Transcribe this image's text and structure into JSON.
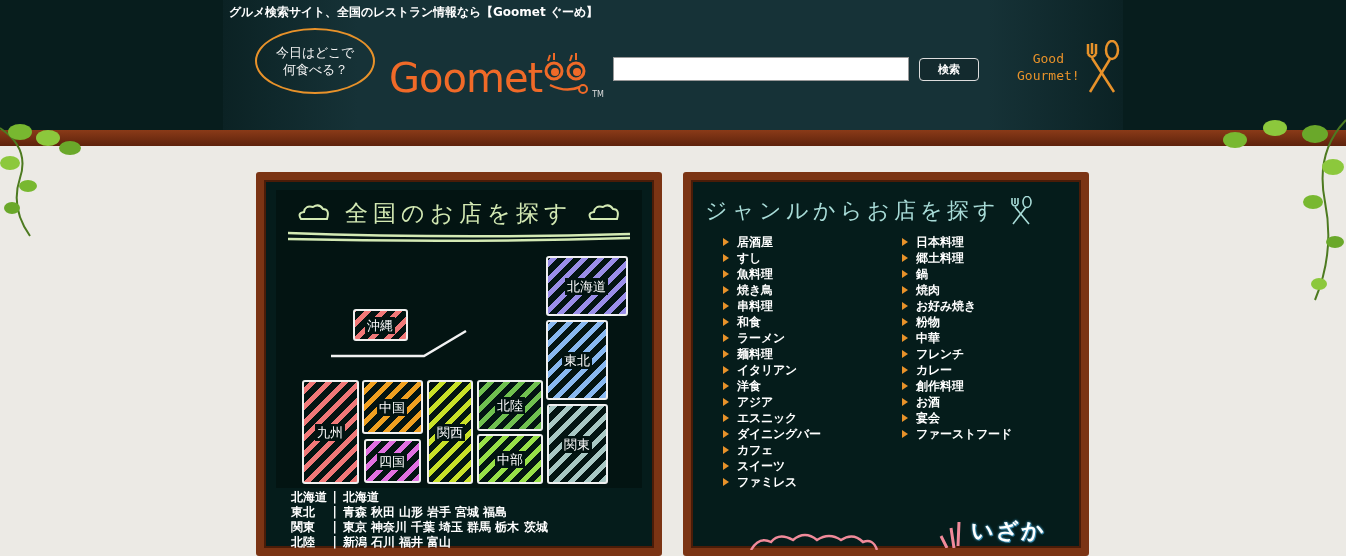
{
  "header": {
    "tagline": "グルメ検索サイト、全国のレストラン情報なら【Goomet ぐーめ】",
    "bubble": [
      "今日はどこで",
      "何食べる？"
    ],
    "logo": "Goomet",
    "trademark": "TM",
    "search": {
      "button": "検索"
    },
    "slogan": [
      "Good",
      "Gourmet!"
    ]
  },
  "area_board": {
    "title": "全国のお店を探す",
    "map": [
      {
        "label": "北海道",
        "color": "#9a8ee8"
      },
      {
        "label": "沖縄",
        "color": "#f07878"
      },
      {
        "label": "東北",
        "color": "#88b8f0"
      },
      {
        "label": "九州",
        "color": "#f07878"
      },
      {
        "label": "中国",
        "color": "#f0a020"
      },
      {
        "label": "四国",
        "color": "#e070e0"
      },
      {
        "label": "関西",
        "color": "#c8e028"
      },
      {
        "label": "北陸",
        "color": "#70c050"
      },
      {
        "label": "中部",
        "color": "#98e048"
      },
      {
        "label": "関東",
        "color": "#a8c8c4"
      }
    ],
    "regions": [
      {
        "area": "北海道",
        "divider": "|",
        "prefectures": "北海道"
      },
      {
        "area": "東北",
        "divider": "|",
        "prefectures": "青森 秋田 山形 岩手 宮城 福島"
      },
      {
        "area": "関東",
        "divider": "|",
        "prefectures": "東京 神奈川 千葉 埼玉 群馬 栃木 茨城"
      },
      {
        "area": "北陸",
        "divider": "|",
        "prefectures": "新潟 石川 福井 富山"
      }
    ]
  },
  "genre_board": {
    "title": "ジャンルからお店を探す",
    "columns": [
      [
        "居酒屋",
        "すし",
        "魚料理",
        "焼き鳥",
        "串料理",
        "和食",
        "ラーメン",
        "麺料理",
        "イタリアン",
        "洋食",
        "アジア",
        "エスニック",
        "ダイニングバー",
        "カフェ",
        "スイーツ",
        "ファミレス"
      ],
      [
        "日本料理",
        "郷土料理",
        "鍋",
        "焼肉",
        "お好み焼き",
        "粉物",
        "中華",
        "フレンチ",
        "カレー",
        "創作料理",
        "お酒",
        "宴会",
        "ファーストフード"
      ]
    ],
    "sticker": "いざか"
  }
}
